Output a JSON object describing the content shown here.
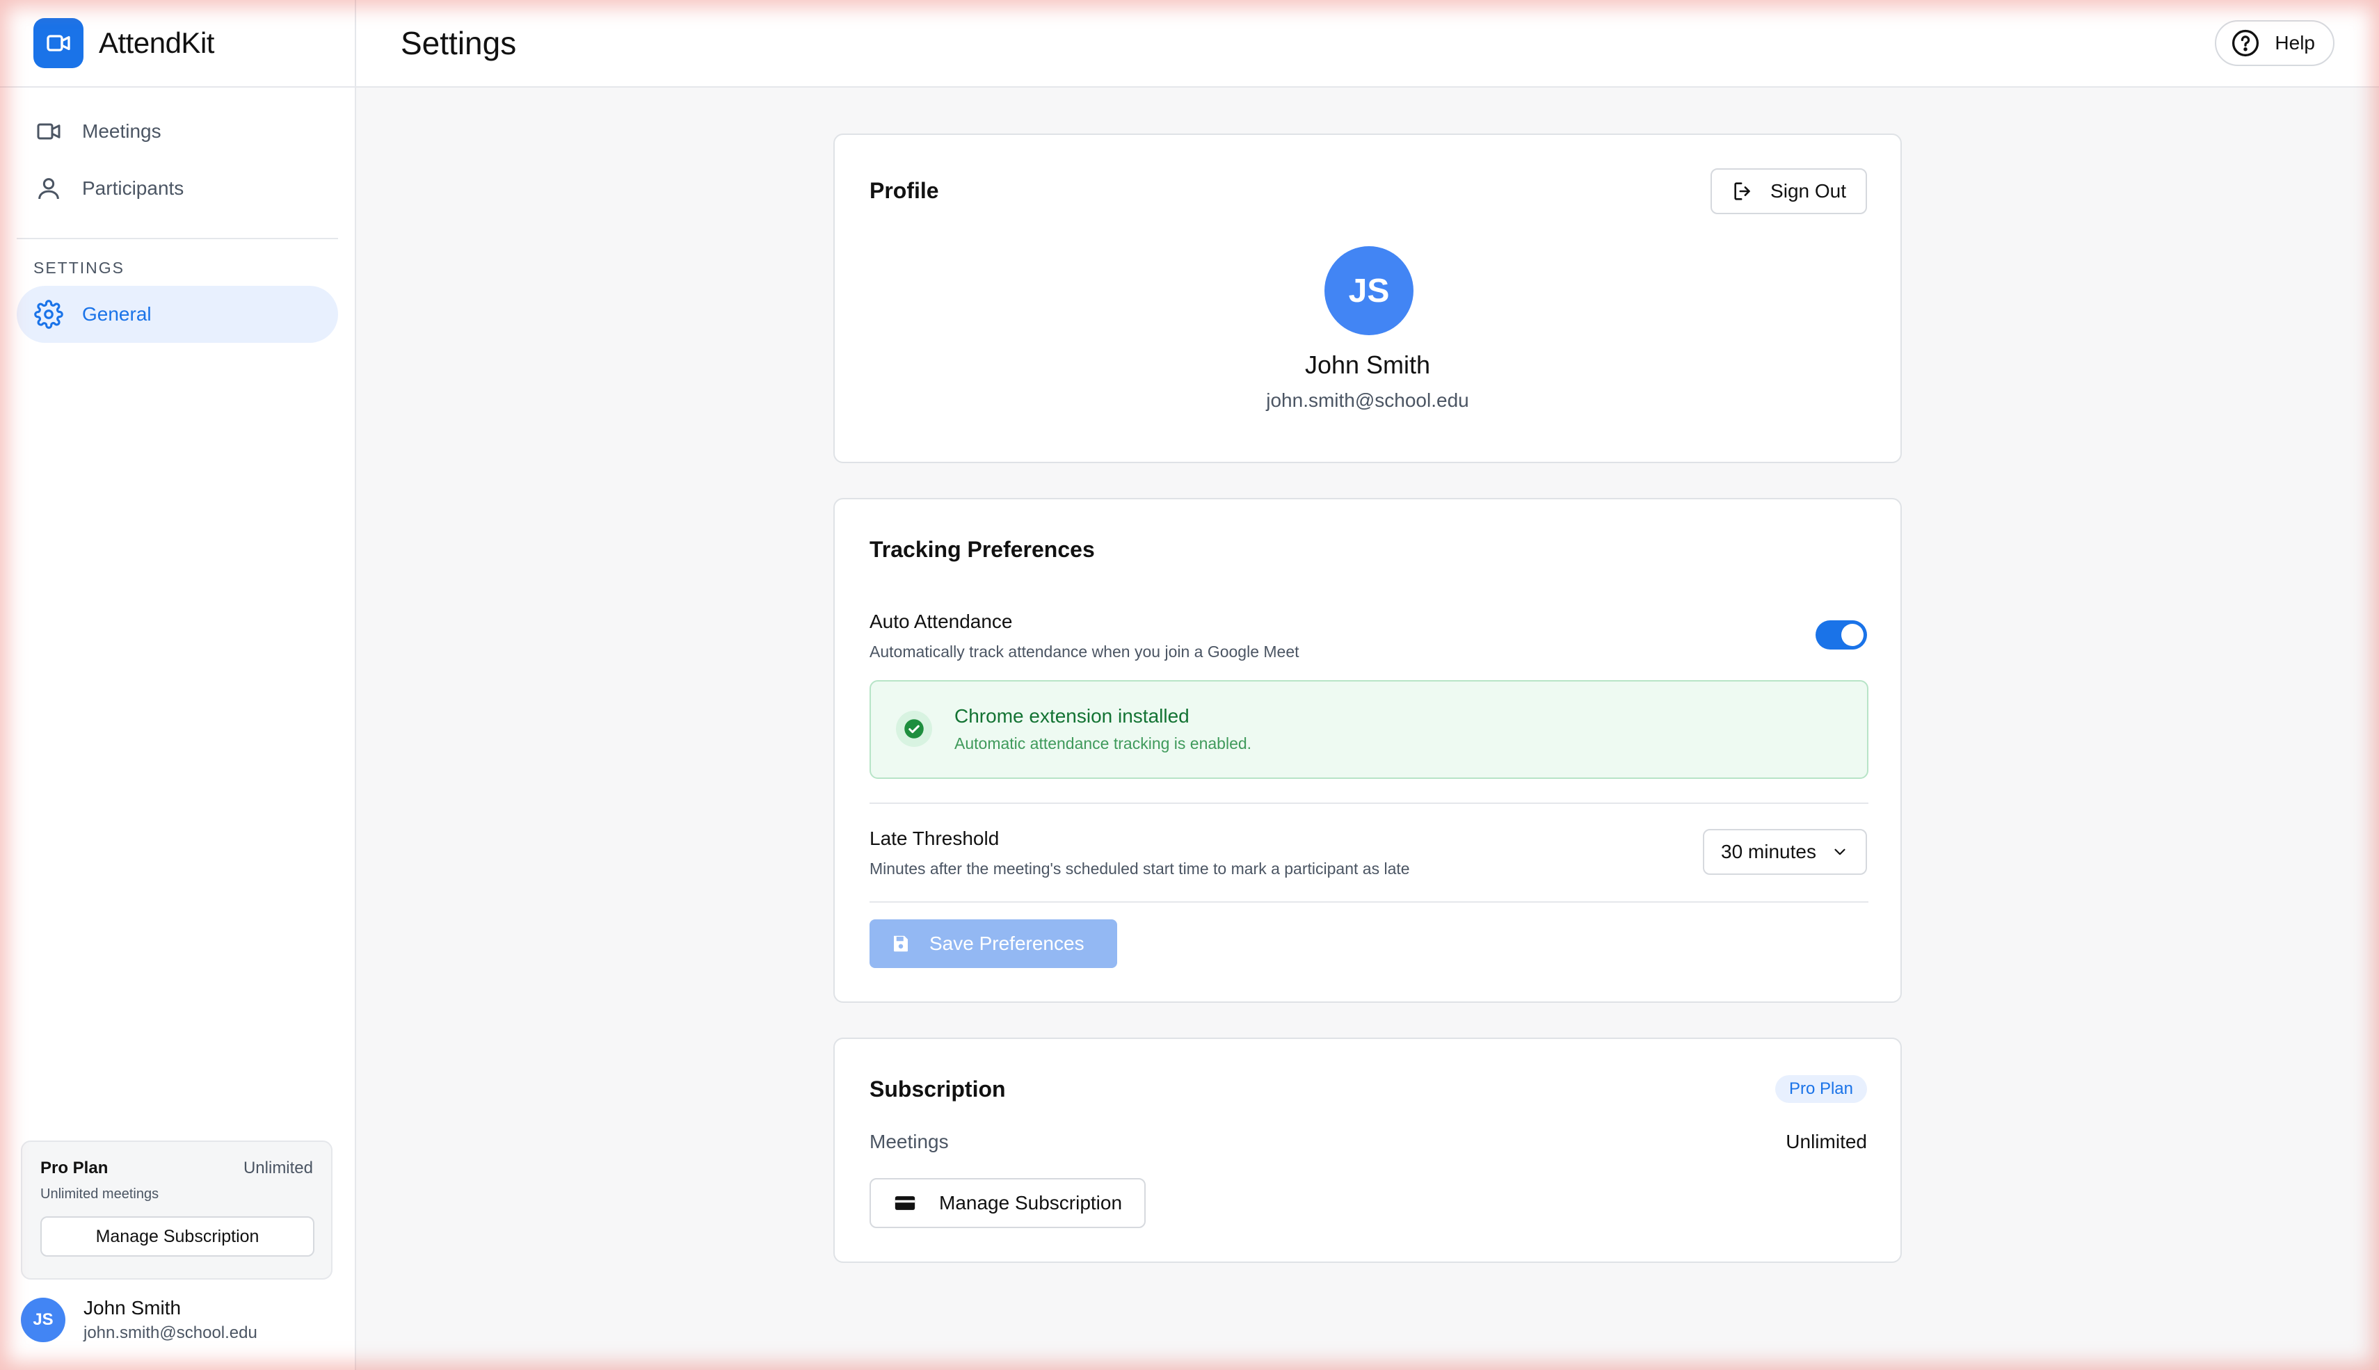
{
  "app": {
    "name": "AttendKit"
  },
  "sidebar": {
    "items": [
      {
        "label": "Meetings",
        "icon": "video-camera-icon"
      },
      {
        "label": "Participants",
        "icon": "person-icon"
      }
    ],
    "section_label": "SETTINGS",
    "settings_items": [
      {
        "label": "General",
        "icon": "gear-icon",
        "active": true
      }
    ],
    "plan": {
      "name": "Pro Plan",
      "limit": "Unlimited",
      "subtitle": "Unlimited meetings",
      "button": "Manage Subscription"
    },
    "user": {
      "initials": "JS",
      "name": "John Smith",
      "email": "john.smith@school.edu"
    }
  },
  "header": {
    "title": "Settings",
    "help_label": "Help"
  },
  "profile": {
    "title": "Profile",
    "sign_out_label": "Sign Out",
    "initials": "JS",
    "name": "John Smith",
    "email": "john.smith@school.edu"
  },
  "tracking": {
    "title": "Tracking Preferences",
    "auto_attendance": {
      "title": "Auto Attendance",
      "description": "Automatically track attendance when you join a Google Meet",
      "enabled": true
    },
    "extension": {
      "title": "Chrome extension installed",
      "description": "Automatic attendance tracking is enabled."
    },
    "late_threshold": {
      "title": "Late Threshold",
      "description": "Minutes after the meeting's scheduled start time to mark a participant as late",
      "value": "30 minutes"
    },
    "save_label": "Save Preferences"
  },
  "subscription": {
    "title": "Subscription",
    "badge": "Pro Plan",
    "meetings_label": "Meetings",
    "meetings_value": "Unlimited",
    "manage_label": "Manage Subscription"
  },
  "colors": {
    "accent": "#1a73e8",
    "avatar": "#4285f4",
    "success_bg": "#eefaf2",
    "success_text": "#137333"
  }
}
